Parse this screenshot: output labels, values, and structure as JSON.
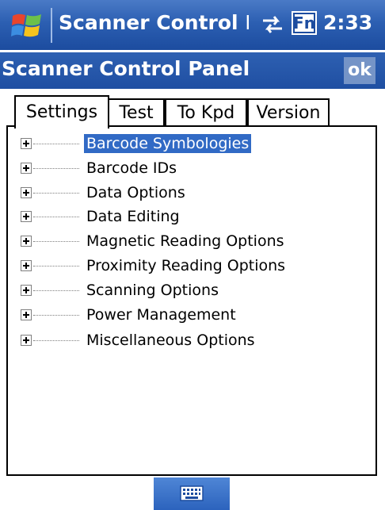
{
  "titlebar": {
    "title": "Scanner Control Pa",
    "clock": "2:33",
    "fn_label": "Fn",
    "start_icon": "windows-flag-icon",
    "connectivity_icon": "connectivity-arrows-icon"
  },
  "header": {
    "title": "Scanner Control Panel",
    "ok_label": "ok"
  },
  "tabs": [
    {
      "label": "Settings",
      "active": true
    },
    {
      "label": "Test",
      "active": false
    },
    {
      "label": "To Kpd",
      "active": false
    },
    {
      "label": "Version",
      "active": false
    }
  ],
  "tree": {
    "items": [
      {
        "label": "Barcode Symbologies",
        "selected": true
      },
      {
        "label": "Barcode IDs"
      },
      {
        "label": "Data Options"
      },
      {
        "label": "Data Editing"
      },
      {
        "label": "Magnetic Reading Options"
      },
      {
        "label": "Proximity Reading Options"
      },
      {
        "label": "Scanning Options"
      },
      {
        "label": "Power Management"
      },
      {
        "label": "Miscellaneous Options"
      }
    ]
  },
  "bottombar": {
    "sip_icon": "keyboard-icon"
  },
  "colors": {
    "titlebar": "#2c5fb2",
    "header": "#1f4fa2",
    "selection": "#316ac5"
  }
}
